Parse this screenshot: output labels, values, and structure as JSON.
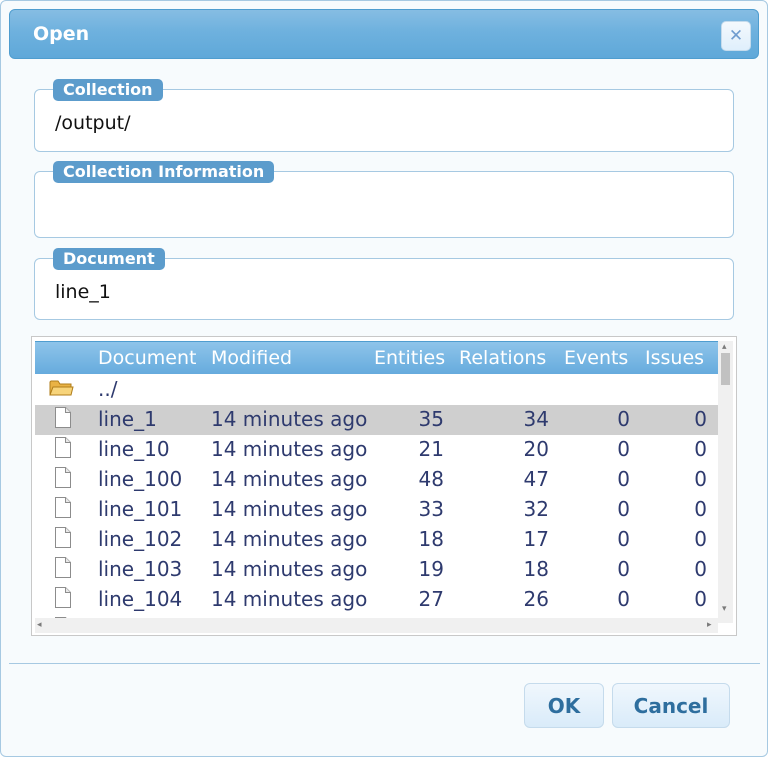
{
  "dialog": {
    "title": "Open"
  },
  "collection": {
    "legend": "Collection",
    "value": "/output/"
  },
  "collection_info": {
    "legend": "Collection Information",
    "value": ""
  },
  "document": {
    "legend": "Document",
    "value": "line_1"
  },
  "table": {
    "headers": {
      "document": "Document",
      "modified": "Modified",
      "entities": "Entities",
      "relations": "Relations",
      "events": "Events",
      "issues": "Issues"
    },
    "parent": {
      "name": "../",
      "icon": "folder-icon"
    },
    "rows": [
      {
        "name": "line_1",
        "modified": "14 minutes ago",
        "entities": "35",
        "relations": "34",
        "events": "0",
        "issues": "0"
      },
      {
        "name": "line_10",
        "modified": "14 minutes ago",
        "entities": "21",
        "relations": "20",
        "events": "0",
        "issues": "0"
      },
      {
        "name": "line_100",
        "modified": "14 minutes ago",
        "entities": "48",
        "relations": "47",
        "events": "0",
        "issues": "0"
      },
      {
        "name": "line_101",
        "modified": "14 minutes ago",
        "entities": "33",
        "relations": "32",
        "events": "0",
        "issues": "0"
      },
      {
        "name": "line_102",
        "modified": "14 minutes ago",
        "entities": "18",
        "relations": "17",
        "events": "0",
        "issues": "0"
      },
      {
        "name": "line_103",
        "modified": "14 minutes ago",
        "entities": "19",
        "relations": "18",
        "events": "0",
        "issues": "0"
      },
      {
        "name": "line_104",
        "modified": "14 minutes ago",
        "entities": "27",
        "relations": "26",
        "events": "0",
        "issues": "0"
      }
    ],
    "selected_row": "line_1"
  },
  "buttons": {
    "ok": "OK",
    "cancel": "Cancel"
  },
  "colors": {
    "accent": "#5c9ccc",
    "header_top": "#8ec4ea",
    "selected_row": "#cfcfcf"
  }
}
